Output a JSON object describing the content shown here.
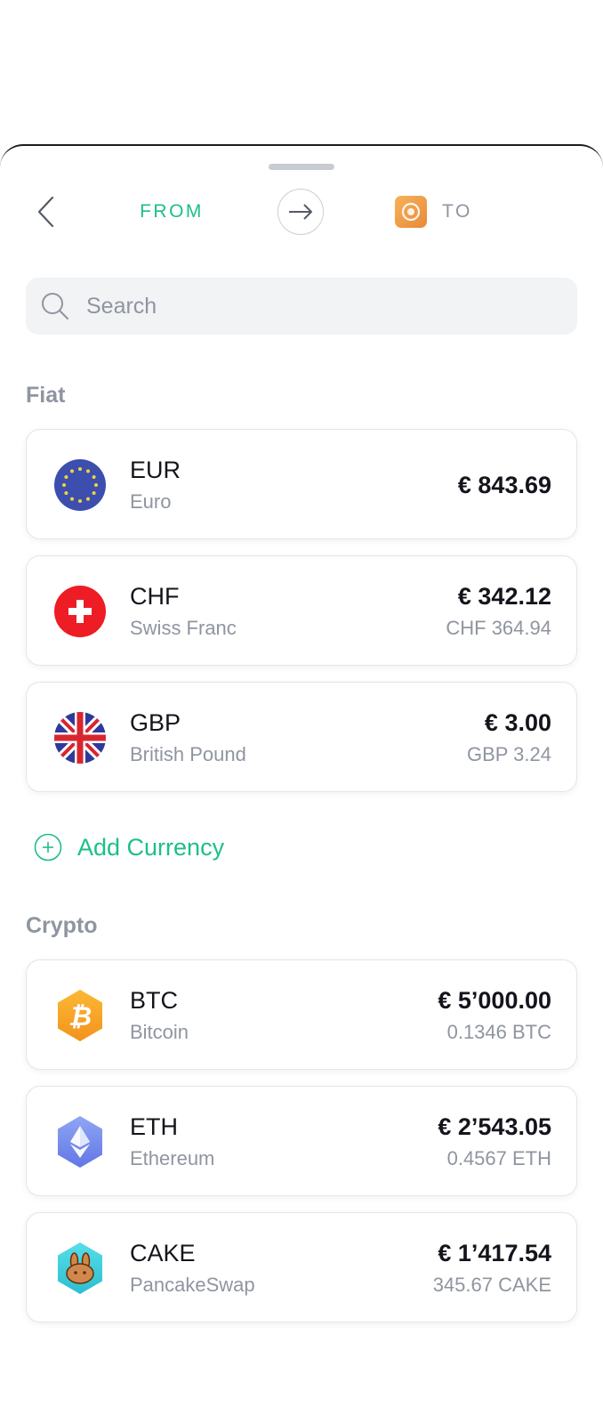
{
  "header": {
    "from_label": "FROM",
    "to_label": "TO",
    "accent_color": "#1cbf8a"
  },
  "search": {
    "placeholder": "Search",
    "value": ""
  },
  "fiat": {
    "title": "Fiat",
    "items": [
      {
        "code": "EUR",
        "name": "Euro",
        "fiat_value": "€ 843.69",
        "native_value": "",
        "icon": "eu-flag-icon"
      },
      {
        "code": "CHF",
        "name": "Swiss Franc",
        "fiat_value": "€ 342.12",
        "native_value": "CHF 364.94",
        "icon": "swiss-flag-icon"
      },
      {
        "code": "GBP",
        "name": "British Pound",
        "fiat_value": "€ 3.00",
        "native_value": "GBP 3.24",
        "icon": "uk-flag-icon"
      }
    ],
    "add_label": "Add Currency"
  },
  "crypto": {
    "title": "Crypto",
    "items": [
      {
        "code": "BTC",
        "name": "Bitcoin",
        "fiat_value": "€ 5’000.00",
        "native_value": "0.1346 BTC",
        "icon": "bitcoin-icon"
      },
      {
        "code": "ETH",
        "name": "Ethereum",
        "fiat_value": "€ 2’543.05",
        "native_value": "0.4567 ETH",
        "icon": "ethereum-icon"
      },
      {
        "code": "CAKE",
        "name": "PancakeSwap",
        "fiat_value": "€ 1’417.54",
        "native_value": "345.67 CAKE",
        "icon": "pancakeswap-icon"
      }
    ]
  }
}
